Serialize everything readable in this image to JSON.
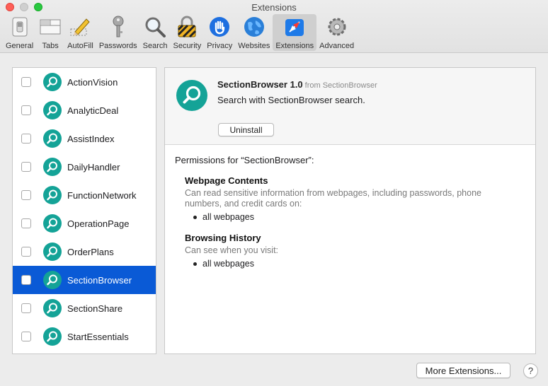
{
  "window": {
    "title": "Extensions"
  },
  "toolbar": {
    "items": [
      {
        "label": "General",
        "icon": "switch-icon"
      },
      {
        "label": "Tabs",
        "icon": "tabs-icon"
      },
      {
        "label": "AutoFill",
        "icon": "pencil-icon"
      },
      {
        "label": "Passwords",
        "icon": "key-icon"
      },
      {
        "label": "Search",
        "icon": "magnifier-icon"
      },
      {
        "label": "Security",
        "icon": "padlock-icon"
      },
      {
        "label": "Privacy",
        "icon": "hand-icon"
      },
      {
        "label": "Websites",
        "icon": "globe-icon"
      },
      {
        "label": "Extensions",
        "icon": "extensions-icon",
        "active": true
      },
      {
        "label": "Advanced",
        "icon": "gear-icon"
      }
    ]
  },
  "extensions": {
    "items": [
      {
        "name": "ActionVision",
        "enabled": false
      },
      {
        "name": "AnalyticDeal",
        "enabled": false
      },
      {
        "name": "AssistIndex",
        "enabled": false
      },
      {
        "name": "DailyHandler",
        "enabled": false
      },
      {
        "name": "FunctionNetwork",
        "enabled": false
      },
      {
        "name": "OperationPage",
        "enabled": false
      },
      {
        "name": "OrderPlans",
        "enabled": false
      },
      {
        "name": "SectionBrowser",
        "enabled": false,
        "selected": true
      },
      {
        "name": "SectionShare",
        "enabled": false
      },
      {
        "name": "StartEssentials",
        "enabled": false
      }
    ]
  },
  "detail": {
    "name_version": "SectionBrowser 1.0",
    "from": "from SectionBrowser",
    "description": "Search with SectionBrowser search.",
    "uninstall_label": "Uninstall",
    "permissions_heading": "Permissions for “SectionBrowser”:",
    "sections": [
      {
        "title": "Webpage Contents",
        "text": "Can read sensitive information from webpages, including passwords, phone numbers, and credit cards on:",
        "bullets": [
          "all webpages"
        ]
      },
      {
        "title": "Browsing History",
        "text": "Can see when you visit:",
        "bullets": [
          "all webpages"
        ]
      }
    ]
  },
  "footer": {
    "more_label": "More Extensions...",
    "help_label": "?"
  },
  "colors": {
    "accent": "#0a5ad6",
    "extension_icon": "#14a397"
  }
}
